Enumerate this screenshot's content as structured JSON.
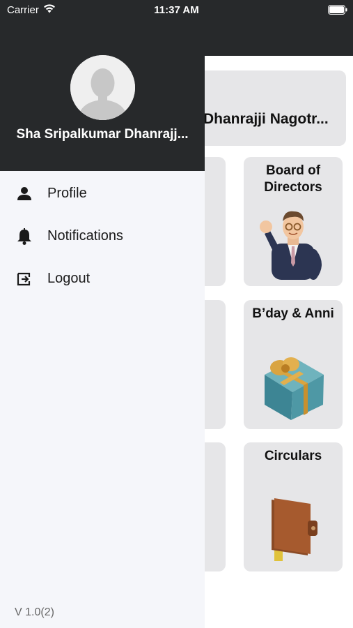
{
  "status_bar": {
    "carrier": "Carrier",
    "time": "11:37 AM"
  },
  "background": {
    "org_name": "Dhanrajji Nagotr...",
    "tiles": [
      {
        "title": "Board of\nDirectors"
      },
      {
        "title": "B’day & Anni"
      },
      {
        "title": "Circulars"
      }
    ]
  },
  "drawer": {
    "user_name": "Sha Sripalkumar Dhanrajj...",
    "menu": [
      {
        "label": "Profile",
        "icon": "person-icon"
      },
      {
        "label": "Notifications",
        "icon": "bell-icon"
      },
      {
        "label": "Logout",
        "icon": "logout-icon"
      }
    ],
    "version": "V 1.0(2)"
  }
}
